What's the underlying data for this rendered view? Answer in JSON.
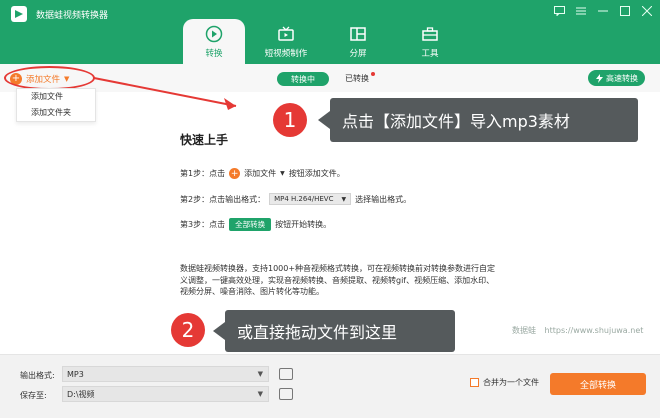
{
  "app": {
    "title": "数据蛙视频转换器"
  },
  "tabs": [
    {
      "label": "转换",
      "icon": "convert-icon",
      "active": true
    },
    {
      "label": "短视频制作",
      "icon": "tv-icon",
      "active": false
    },
    {
      "label": "分屏",
      "icon": "split-screen-icon",
      "active": false
    },
    {
      "label": "工具",
      "icon": "toolbox-icon",
      "active": false
    }
  ],
  "toolbar": {
    "add_file": "添加文件",
    "converting": "转换中",
    "converted": "已转换",
    "fast_convert": "高速转换"
  },
  "menu": {
    "items": [
      "添加文件",
      "添加文件夹"
    ]
  },
  "quick_start": {
    "title": "快速上手",
    "step1": {
      "prefix": "第1步：点击",
      "button": "添加文件",
      "suffix": "按钮添加文件。"
    },
    "step2": {
      "prefix": "第2步：点击输出格式：",
      "format": "MP4 H.264/HEVC",
      "suffix": "选择输出格式。"
    },
    "step3": {
      "prefix": "第3步：点击",
      "button": "全部转换",
      "suffix": "按钮开始转换。"
    },
    "description": "数据蛙视频转换器，支持1000+种音视频格式转换，可在视频转换前对转换参数进行自定义调整，一键高效处理，实现音视频转换、音频提取、视频转gif、视频压缩、添加水印、视频分屏、噪音消除、图片转化等功能。"
  },
  "callouts": {
    "first": {
      "number": "1",
      "text": "点击【添加文件】导入mp3素材"
    },
    "second": {
      "number": "2",
      "text": "或直接拖动文件到这里"
    }
  },
  "watermark": {
    "brand": "数据蛙",
    "url": "https://www.shujuwa.net"
  },
  "bottom": {
    "output_format_label": "输出格式:",
    "output_format_value": "MP3",
    "save_to_label": "保存至:",
    "save_to_value": "D:\\视频",
    "merge_label": "合并为一个文件",
    "convert_all": "全部转换"
  },
  "colors": {
    "primary": "#1fa36a",
    "accent": "#f47a2a",
    "annotation": "#e53935",
    "callout": "#555a5c"
  }
}
